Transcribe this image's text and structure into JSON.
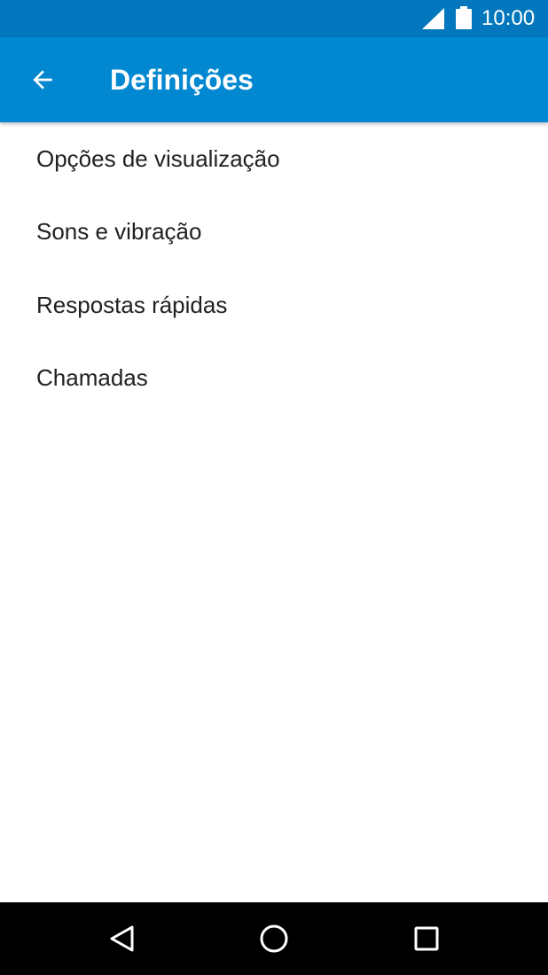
{
  "status_bar": {
    "time": "10:00",
    "icons": [
      "signal-icon",
      "battery-icon"
    ]
  },
  "app_bar": {
    "title": "Definições",
    "back_icon": "arrow-back-icon",
    "background": "#0288D1"
  },
  "settings": {
    "items": [
      {
        "label": "Opções de visualização"
      },
      {
        "label": "Sons e vibração"
      },
      {
        "label": "Respostas rápidas"
      },
      {
        "label": "Chamadas"
      }
    ]
  },
  "nav_bar": {
    "icons": [
      "nav-back-icon",
      "nav-home-icon",
      "nav-recents-icon"
    ]
  },
  "colors": {
    "status_bar": "#0277BD",
    "app_bar": "#0288D1",
    "text_primary": "#212121"
  }
}
